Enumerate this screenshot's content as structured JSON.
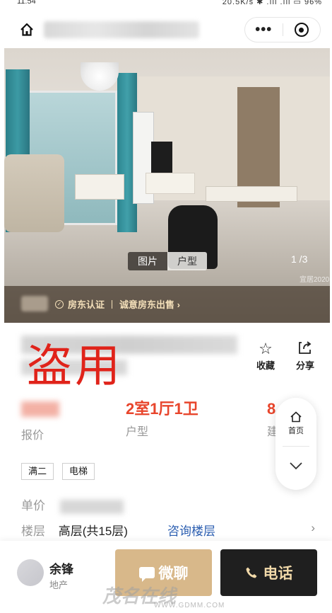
{
  "status_bar": {
    "time": "11:54",
    "right": "20.5K/s ✱ ⁠.ıll ⁠.ıll ▭ 96%"
  },
  "nav": {
    "more_label": "•••"
  },
  "photo": {
    "tabs": [
      {
        "label": "图片",
        "active": true
      },
      {
        "label": "户型",
        "active": false
      }
    ],
    "counter": "1 /3",
    "watermark": "宜居2020",
    "cert_label": "房东认证",
    "cert_sale": "诚意房东出售 ›"
  },
  "overlay": {
    "stolen": "盗用"
  },
  "actions": {
    "favorite": "收藏",
    "share": "分享"
  },
  "stats": {
    "price_label": "报价",
    "layout_value": "2室1厅1卫",
    "layout_label": "户型",
    "area_value_partial": "8",
    "area_label_partial": "建"
  },
  "float_panel": {
    "home_label": "首页"
  },
  "tags": [
    "满二",
    "电梯"
  ],
  "details": {
    "unit_price_label": "单价",
    "floor_label": "楼层",
    "floor_value": "高层(共15层)",
    "floor_link": "咨询楼层",
    "arrow": "›"
  },
  "agent": {
    "name": "余锋",
    "company": "地产"
  },
  "buttons": {
    "chat": "微聊",
    "call": "电话"
  },
  "site_watermark": {
    "name": "茂名在线",
    "url": "WWW.GDMM.COM"
  }
}
